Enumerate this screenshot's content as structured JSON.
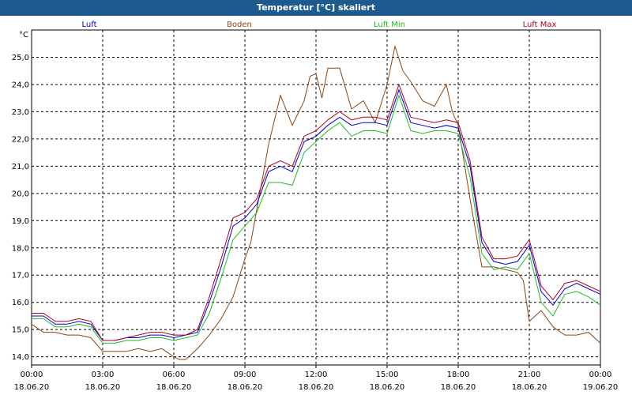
{
  "window": {
    "title": "Temperatur [°C] skaliert"
  },
  "chart_data": {
    "type": "line",
    "title": "Temperatur [°C] skaliert",
    "ylabel": "°C",
    "ylim": [
      13.7,
      26.0
    ],
    "xlim": [
      "18.06.20 00:00",
      "19.06.20 00:00"
    ],
    "grid": true,
    "legend_position": "top",
    "y_ticks": [
      "14,0",
      "15,0",
      "16,0",
      "17,0",
      "18,0",
      "19,0",
      "20,0",
      "21,0",
      "22,0",
      "23,0",
      "24,0",
      "25,0"
    ],
    "x_ticks": [
      {
        "time": "00:00",
        "date": "18.06.20"
      },
      {
        "time": "03:00",
        "date": "18.06.20"
      },
      {
        "time": "06:00",
        "date": "18.06.20"
      },
      {
        "time": "09:00",
        "date": "18.06.20"
      },
      {
        "time": "12:00",
        "date": "18.06.20"
      },
      {
        "time": "15:00",
        "date": "18.06.20"
      },
      {
        "time": "18:00",
        "date": "18.06.20"
      },
      {
        "time": "21:00",
        "date": "18.06.20"
      },
      {
        "time": "00:00",
        "date": "19.06.20"
      }
    ],
    "series": [
      {
        "name": "Boden",
        "color": "#8b4513",
        "x": [
          "18.06.20 00:00",
          "18.06.20 00:30",
          "18.06.20 01:00",
          "18.06.20 01:30",
          "18.06.20 02:00",
          "18.06.20 02:30",
          "18.06.20 03:00",
          "18.06.20 03:30",
          "18.06.20 04:00",
          "18.06.20 04:30",
          "18.06.20 05:00",
          "18.06.20 05:30",
          "18.06.20 06:00",
          "18.06.20 06:15",
          "18.06.20 06:30",
          "18.06.20 07:00",
          "18.06.20 07:30",
          "18.06.20 08:00",
          "18.06.20 08:30",
          "18.06.20 09:00",
          "18.06.20 09:15",
          "18.06.20 09:30",
          "18.06.20 10:00",
          "18.06.20 10:30",
          "18.06.20 11:00",
          "18.06.20 11:30",
          "18.06.20 11:45",
          "18.06.20 12:00",
          "18.06.20 12:15",
          "18.06.20 12:30",
          "18.06.20 13:00",
          "18.06.20 13:30",
          "18.06.20 14:00",
          "18.06.20 14:30",
          "18.06.20 15:00",
          "18.06.20 15:20",
          "18.06.20 15:40",
          "18.06.20 16:00",
          "18.06.20 16:30",
          "18.06.20 17:00",
          "18.06.20 17:30",
          "18.06.20 17:45",
          "18.06.20 18:00",
          "18.06.20 18:30",
          "18.06.20 19:00",
          "18.06.20 19:30",
          "18.06.20 20:00",
          "18.06.20 20:30",
          "18.06.20 20:45",
          "18.06.20 21:00",
          "18.06.20 21:30",
          "18.06.20 22:00",
          "18.06.20 22:30",
          "18.06.20 23:00",
          "18.06.20 23:30",
          "19.06.20 00:00"
        ],
        "values": [
          15.2,
          14.9,
          14.9,
          14.8,
          14.8,
          14.7,
          14.2,
          14.2,
          14.2,
          14.3,
          14.2,
          14.3,
          14.0,
          13.9,
          13.9,
          14.3,
          14.8,
          15.4,
          16.2,
          17.6,
          18.2,
          19.4,
          21.8,
          23.6,
          22.5,
          23.4,
          24.3,
          24.4,
          23.5,
          24.6,
          24.6,
          23.1,
          23.4,
          22.6,
          24.0,
          25.4,
          24.5,
          24.1,
          23.4,
          23.2,
          24.0,
          23.0,
          22.5,
          19.8,
          17.3,
          17.3,
          17.2,
          17.1,
          16.8,
          15.3,
          15.7,
          15.1,
          14.8,
          14.8,
          14.9,
          14.5
        ]
      },
      {
        "name": "Luft",
        "color": "#0000cc",
        "x": [
          "18.06.20 00:00",
          "18.06.20 00:30",
          "18.06.20 01:00",
          "18.06.20 01:30",
          "18.06.20 02:00",
          "18.06.20 02:30",
          "18.06.20 03:00",
          "18.06.20 03:30",
          "18.06.20 04:00",
          "18.06.20 04:30",
          "18.06.20 05:00",
          "18.06.20 05:30",
          "18.06.20 06:00",
          "18.06.20 06:30",
          "18.06.20 07:00",
          "18.06.20 07:30",
          "18.06.20 08:00",
          "18.06.20 08:30",
          "18.06.20 09:00",
          "18.06.20 09:30",
          "18.06.20 10:00",
          "18.06.20 10:30",
          "18.06.20 11:00",
          "18.06.20 11:30",
          "18.06.20 12:00",
          "18.06.20 12:30",
          "18.06.20 13:00",
          "18.06.20 13:30",
          "18.06.20 14:00",
          "18.06.20 14:30",
          "18.06.20 15:00",
          "18.06.20 15:30",
          "18.06.20 16:00",
          "18.06.20 16:30",
          "18.06.20 17:00",
          "18.06.20 17:30",
          "18.06.20 18:00",
          "18.06.20 18:30",
          "18.06.20 19:00",
          "18.06.20 19:30",
          "18.06.20 20:00",
          "18.06.20 20:30",
          "18.06.20 21:00",
          "18.06.20 21:30",
          "18.06.20 22:00",
          "18.06.20 22:30",
          "18.06.20 23:00",
          "18.06.20 23:30",
          "19.06.20 00:00"
        ],
        "values": [
          15.5,
          15.5,
          15.2,
          15.2,
          15.3,
          15.2,
          14.6,
          14.6,
          14.7,
          14.7,
          14.8,
          14.8,
          14.7,
          14.8,
          14.9,
          16.0,
          17.3,
          18.8,
          19.1,
          19.6,
          20.8,
          21.0,
          20.8,
          21.9,
          22.1,
          22.5,
          22.8,
          22.5,
          22.6,
          22.6,
          22.5,
          23.8,
          22.6,
          22.5,
          22.4,
          22.5,
          22.4,
          21.0,
          18.2,
          17.5,
          17.4,
          17.5,
          18.1,
          16.4,
          15.9,
          16.5,
          16.7,
          16.5,
          16.3
        ]
      },
      {
        "name": "Luft Min",
        "color": "#22bb22",
        "x": [
          "18.06.20 00:00",
          "18.06.20 00:30",
          "18.06.20 01:00",
          "18.06.20 01:30",
          "18.06.20 02:00",
          "18.06.20 02:30",
          "18.06.20 03:00",
          "18.06.20 03:30",
          "18.06.20 04:00",
          "18.06.20 04:30",
          "18.06.20 05:00",
          "18.06.20 05:30",
          "18.06.20 06:00",
          "18.06.20 06:30",
          "18.06.20 07:00",
          "18.06.20 07:30",
          "18.06.20 08:00",
          "18.06.20 08:30",
          "18.06.20 09:00",
          "18.06.20 09:30",
          "18.06.20 10:00",
          "18.06.20 10:30",
          "18.06.20 11:00",
          "18.06.20 11:30",
          "18.06.20 12:00",
          "18.06.20 12:30",
          "18.06.20 13:00",
          "18.06.20 13:30",
          "18.06.20 14:00",
          "18.06.20 14:30",
          "18.06.20 15:00",
          "18.06.20 15:30",
          "18.06.20 16:00",
          "18.06.20 16:30",
          "18.06.20 17:00",
          "18.06.20 17:30",
          "18.06.20 18:00",
          "18.06.20 18:30",
          "18.06.20 19:00",
          "18.06.20 19:30",
          "18.06.20 20:00",
          "18.06.20 20:30",
          "18.06.20 21:00",
          "18.06.20 21:30",
          "18.06.20 22:00",
          "18.06.20 22:30",
          "18.06.20 23:00",
          "18.06.20 23:30",
          "19.06.20 00:00"
        ],
        "values": [
          15.4,
          15.4,
          15.1,
          15.1,
          15.2,
          15.1,
          14.5,
          14.5,
          14.6,
          14.6,
          14.7,
          14.7,
          14.6,
          14.7,
          14.8,
          15.6,
          16.9,
          18.3,
          18.8,
          19.3,
          20.4,
          20.4,
          20.3,
          21.5,
          21.9,
          22.3,
          22.6,
          22.1,
          22.3,
          22.3,
          22.2,
          23.6,
          22.3,
          22.2,
          22.3,
          22.3,
          22.2,
          20.6,
          17.8,
          17.2,
          17.3,
          17.2,
          17.8,
          16.0,
          15.5,
          16.3,
          16.4,
          16.2,
          15.9
        ]
      },
      {
        "name": "Luft Max",
        "color": "#aa0022",
        "x": [
          "18.06.20 00:00",
          "18.06.20 00:30",
          "18.06.20 01:00",
          "18.06.20 01:30",
          "18.06.20 02:00",
          "18.06.20 02:30",
          "18.06.20 03:00",
          "18.06.20 03:30",
          "18.06.20 04:00",
          "18.06.20 04:30",
          "18.06.20 05:00",
          "18.06.20 05:30",
          "18.06.20 06:00",
          "18.06.20 06:30",
          "18.06.20 07:00",
          "18.06.20 07:30",
          "18.06.20 08:00",
          "18.06.20 08:30",
          "18.06.20 09:00",
          "18.06.20 09:30",
          "18.06.20 10:00",
          "18.06.20 10:30",
          "18.06.20 11:00",
          "18.06.20 11:30",
          "18.06.20 12:00",
          "18.06.20 12:30",
          "18.06.20 13:00",
          "18.06.20 13:30",
          "18.06.20 14:00",
          "18.06.20 14:30",
          "18.06.20 15:00",
          "18.06.20 15:30",
          "18.06.20 16:00",
          "18.06.20 16:30",
          "18.06.20 17:00",
          "18.06.20 17:30",
          "18.06.20 18:00",
          "18.06.20 18:30",
          "18.06.20 19:00",
          "18.06.20 19:30",
          "18.06.20 20:00",
          "18.06.20 20:30",
          "18.06.20 21:00",
          "18.06.20 21:30",
          "18.06.20 22:00",
          "18.06.20 22:30",
          "18.06.20 23:00",
          "18.06.20 23:30",
          "19.06.20 00:00"
        ],
        "values": [
          15.6,
          15.6,
          15.3,
          15.3,
          15.4,
          15.3,
          14.6,
          14.6,
          14.7,
          14.8,
          14.9,
          14.9,
          14.8,
          14.8,
          15.0,
          16.2,
          17.6,
          19.1,
          19.3,
          19.8,
          21.0,
          21.2,
          21.0,
          22.1,
          22.3,
          22.7,
          23.0,
          22.7,
          22.8,
          22.8,
          22.7,
          24.0,
          22.8,
          22.7,
          22.6,
          22.7,
          22.6,
          21.2,
          18.4,
          17.6,
          17.6,
          17.7,
          18.3,
          16.6,
          16.1,
          16.7,
          16.8,
          16.6,
          16.4
        ]
      }
    ]
  }
}
